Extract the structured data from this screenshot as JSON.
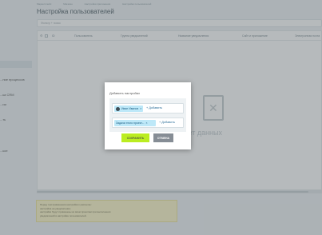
{
  "breadcrumbs": [
    "Маркетплейс",
    "Магазин",
    "Настройки приложения",
    "Настройки пользователей"
  ],
  "page": {
    "title": "Настройка пользователей"
  },
  "sidebar": {
    "items": [
      "...ние процессов",
      "...ка CRM",
      "...ии",
      "...ть",
      "...кое"
    ]
  },
  "filter": {
    "placeholder": "Фильтр + поиск"
  },
  "table": {
    "columns": [
      "ID",
      "Пользователь",
      "Группа уведомлений",
      "Название уведомления",
      "Сайт и приложение",
      "Электронная почта"
    ]
  },
  "empty_state": {
    "text": "Нет данных"
  },
  "notice": {
    "lines": [
      "Перед тем применения настройки к рассылке:",
      "  настройка на уведомлении;",
      "  настройки будут применены ко всем проектам при выполнении",
      "  уведомлений в настройке пользователей."
    ]
  },
  "dialog": {
    "title": "Добавить настройки",
    "rows": [
      {
        "tag": "Иван Иванов",
        "add_label": "+ Добавить",
        "has_avatar": true
      },
      {
        "tag": "Задачи этого проект...",
        "add_label": "+ Добавить",
        "has_avatar": false
      }
    ],
    "save_label": "СОХРАНИТЬ",
    "cancel_label": "ОТМЕНА"
  },
  "colors": {
    "save_button": "#bbed21",
    "cancel_button": "#868d95",
    "tag_background": "#bde8f8",
    "notice_background": "#fdf6c8"
  }
}
